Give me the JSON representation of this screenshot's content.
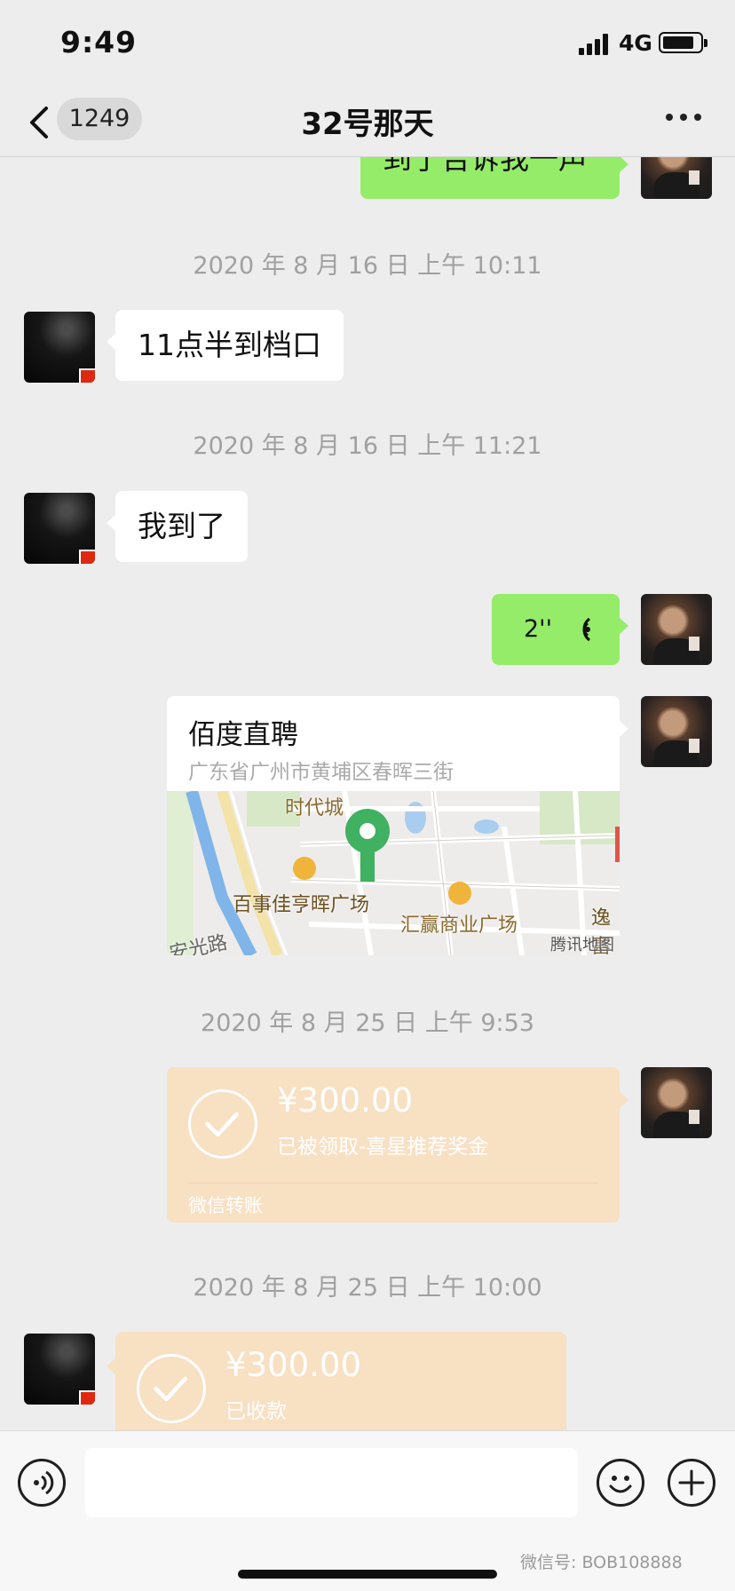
{
  "status_bar": {
    "time": "9:49",
    "network": "4G"
  },
  "nav": {
    "back_count": "1249",
    "title": "32号那天"
  },
  "messages": {
    "top_partial": "到了告诉我一声",
    "ts1": "2020 年 8 月 16 日 上午 10:11",
    "msg1": "11点半到档口",
    "ts2": "2020 年 8 月 16 日 上午 11:21",
    "msg2": "我到了",
    "voice_length": "2''",
    "location": {
      "name": "佰度直聘",
      "address": "广东省广州市黄埔区春晖三街",
      "map_labels": [
        "时代城",
        "百事佳亨晖广场",
        "汇赢商业广场",
        "安光路",
        "逸富"
      ],
      "map_provider": "腾讯地图"
    },
    "ts3": "2020 年 8 月 25 日 上午 9:53",
    "transfer1": {
      "amount": "¥300.00",
      "status": "已被领取-喜星推荐奖金",
      "footer": "微信转账"
    },
    "ts4": "2020 年 8 月 25 日 上午 10:00",
    "transfer2": {
      "amount": "¥300.00",
      "status": "已收款"
    }
  },
  "watermark": "微信号: BOB108888",
  "icons": {
    "back": "chevron-left-icon",
    "more": "more-icon",
    "voice": "voice-icon",
    "emoji": "emoji-icon",
    "add": "plus-icon"
  },
  "colors": {
    "background": "#ededed",
    "self_bubble": "#95ec69",
    "other_bubble": "#ffffff",
    "transfer_card": "#f8e0c3",
    "map_pin": "#3fb160"
  }
}
